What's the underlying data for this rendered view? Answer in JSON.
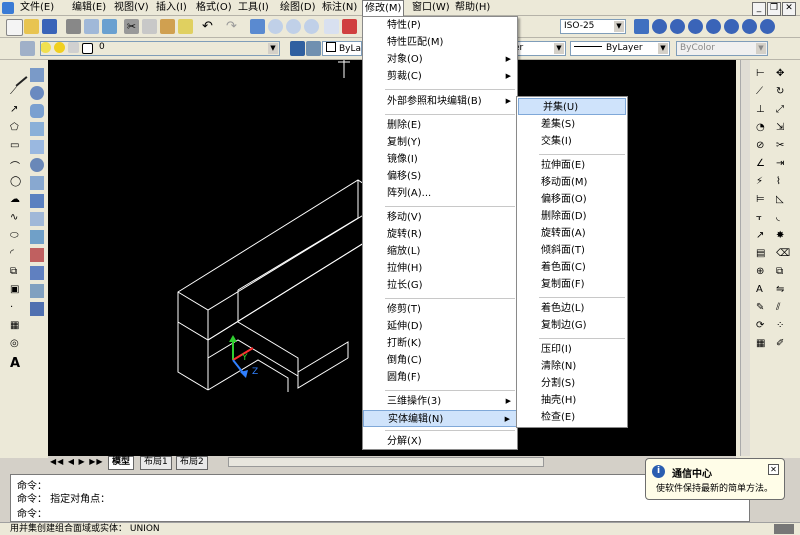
{
  "menubar": {
    "items": [
      "文件(E)",
      "编辑(E)",
      "视图(V)",
      "插入(I)",
      "格式(O)",
      "工具(I)",
      "绘图(D)",
      "标注(N)",
      "修改(M)",
      "窗口(W)",
      "帮助(H)"
    ],
    "active_index": 8
  },
  "toolbar": {
    "layer_value": "0",
    "dimstyle_value": "ISO-25",
    "color_value": "ByLayer",
    "linetype_value": "ByLayer",
    "lineweight_value": "ByLayer",
    "plotstyle_value": "ByColor",
    "linetype_partial": "er"
  },
  "modify_menu": {
    "items": [
      {
        "label": "特性(P)",
        "sub": false
      },
      {
        "label": "特性匹配(M)",
        "sub": false
      },
      {
        "label": "对象(O)",
        "sub": true
      },
      {
        "label": "剪裁(C)",
        "sub": true
      },
      {
        "label": "外部参照和块编辑(B)",
        "sub": true
      },
      {
        "label": "删除(E)",
        "sub": false
      },
      {
        "label": "复制(Y)",
        "sub": false
      },
      {
        "label": "镜像(I)",
        "sub": false
      },
      {
        "label": "偏移(S)",
        "sub": false
      },
      {
        "label": "阵列(A)...",
        "sub": false
      },
      {
        "label": "移动(V)",
        "sub": false
      },
      {
        "label": "旋转(R)",
        "sub": false
      },
      {
        "label": "缩放(L)",
        "sub": false
      },
      {
        "label": "拉伸(H)",
        "sub": false
      },
      {
        "label": "拉长(G)",
        "sub": false
      },
      {
        "label": "修剪(T)",
        "sub": false
      },
      {
        "label": "延伸(D)",
        "sub": false
      },
      {
        "label": "打断(K)",
        "sub": false
      },
      {
        "label": "倒角(C)",
        "sub": false
      },
      {
        "label": "圆角(F)",
        "sub": false
      },
      {
        "label": "三维操作(3)",
        "sub": true
      },
      {
        "label": "实体编辑(N)",
        "sub": true
      },
      {
        "label": "分解(X)",
        "sub": false
      }
    ]
  },
  "solid_edit_menu": {
    "items": [
      "并集(U)",
      "差集(S)",
      "交集(I)",
      "拉伸面(E)",
      "移动面(M)",
      "偏移面(O)",
      "删除面(D)",
      "旋转面(A)",
      "倾斜面(T)",
      "着色面(C)",
      "复制面(F)",
      "着色边(L)",
      "复制边(G)",
      "压印(I)",
      "清除(N)",
      "分割(S)",
      "抽壳(H)",
      "检查(E)"
    ],
    "highlighted": "并集(U)"
  },
  "layout_tabs": [
    "模型",
    "布局1",
    "布局2"
  ],
  "command": {
    "line1": "命令：",
    "line2": "命令： 指定对角点：",
    "line3": "命令："
  },
  "status_bar": {
    "text": "用并集创建组合面域或实体：   UNION"
  },
  "notification": {
    "title": "通信中心",
    "message": "使软件保持最新的简单方法。"
  },
  "ucs": {
    "y": "Y",
    "z": "Z"
  },
  "colors": {
    "canvas": "#000000",
    "menu_highlight": "#cfe3fb",
    "ucs_x": "#ff3030",
    "ucs_y": "#30d030",
    "ucs_z": "#3080ff"
  }
}
